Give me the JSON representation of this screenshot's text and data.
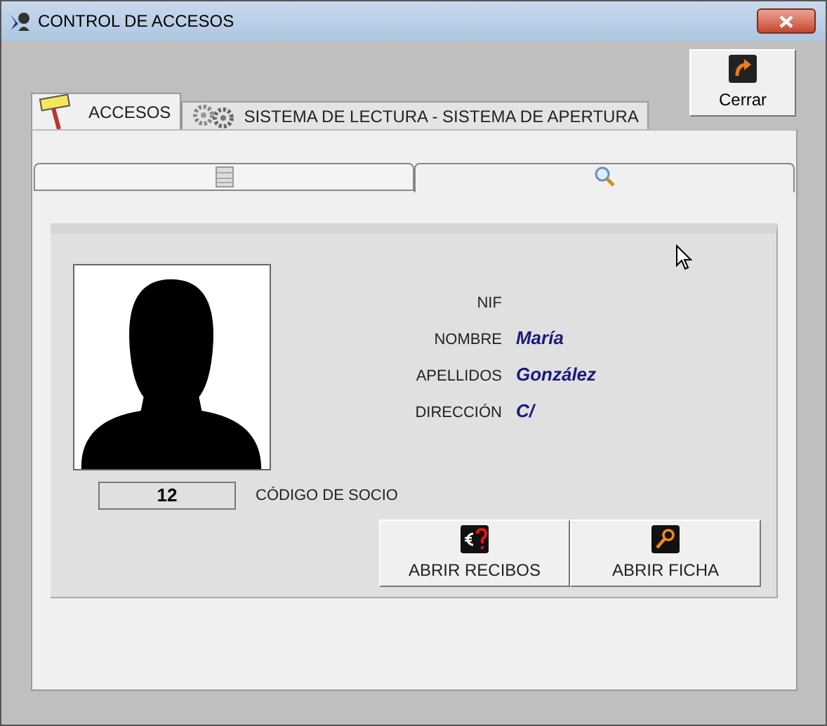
{
  "window": {
    "title": "CONTROL DE ACCESOS"
  },
  "close_button": {
    "label": "Cerrar"
  },
  "tabs": [
    {
      "label": "ACCESOS",
      "kind": "hammer",
      "selected": true
    },
    {
      "label": "SISTEMA DE LECTURA - SISTEMA DE APERTURA",
      "kind": "gears",
      "selected": false
    }
  ],
  "subtabs": [
    {
      "kind": "database",
      "selected": false
    },
    {
      "kind": "search",
      "selected": true
    }
  ],
  "member": {
    "fields": [
      {
        "label": "NIF"
      },
      {
        "label": "NOMBRE",
        "value": "María"
      },
      {
        "label": "APELLIDOS",
        "value": "González"
      },
      {
        "label": "DIRECCIÓN",
        "value": "C/"
      }
    ],
    "code": {
      "value": "12",
      "label": "CÓDIGO DE SOCIO"
    }
  },
  "buttons": [
    {
      "label": "ABRIR RECIBOS",
      "kind": "receipts"
    },
    {
      "label": "ABRIR FICHA",
      "kind": "file"
    }
  ]
}
